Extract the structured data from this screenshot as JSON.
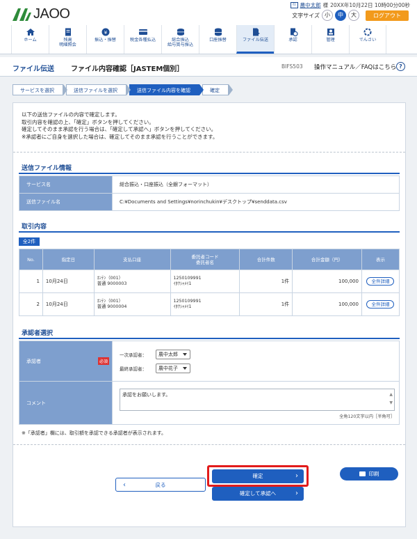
{
  "header": {
    "logo_text": "JAOO",
    "user_badge": "ﾏｽ",
    "user_name": "農中太郎",
    "user_suffix": "様",
    "last_login": "20XX年10月22日 10時00分00秒",
    "font_size_label": "文字サイズ",
    "font_sizes": [
      "小",
      "中",
      "大"
    ],
    "logout_label": "ログアウト"
  },
  "gnav": [
    {
      "label": "ホーム",
      "icon": "home-icon"
    },
    {
      "label": "残高\n明細照会",
      "icon": "document-icon"
    },
    {
      "label": "振込・振替",
      "icon": "yen-coin-icon"
    },
    {
      "label": "税金各種払込",
      "icon": "card-icon"
    },
    {
      "label": "総合振込\n給与賞与振込",
      "icon": "coins-stack-icon"
    },
    {
      "label": "口座振替",
      "icon": "database-icon"
    },
    {
      "label": "ファイル伝送",
      "icon": "file-transfer-icon",
      "active": true
    },
    {
      "label": "承認",
      "icon": "approval-icon"
    },
    {
      "label": "管理",
      "icon": "admin-icon"
    },
    {
      "label": "でんさい",
      "icon": "densai-icon"
    }
  ],
  "titlebar": {
    "service": "ファイル伝送",
    "page_title": "ファイル内容確認［JASTEM個別］",
    "screen_code": "BIFS503",
    "help_text": "操作マニュアル／FAQはこちら",
    "help_icon": "?"
  },
  "steps": [
    "サービスを選択",
    "送信ファイルを選択",
    "送信ファイル内容を確認",
    "確定"
  ],
  "intro_lines": [
    "以下の送信ファイルの内容で確定します。",
    "取引内容を確認の上、「確定」ボタンを押してください。",
    "確定してそのまま承認を行う場合は、「確定して承認へ」ボタンを押してください。",
    "※承認者にご自身を選択した場合は、確定してそのまま承認を行うことができます。"
  ],
  "file_info": {
    "title": "送信ファイル情報",
    "rows": [
      {
        "key": "サービス名",
        "value": "総合振込・口座振込（全銀フォーマット）"
      },
      {
        "key": "送信ファイル名",
        "value": "C:¥Documents and Settings¥norinchukin¥デスクトップ¥senddata.csv"
      }
    ]
  },
  "transactions": {
    "title": "取引内容",
    "count_label": "全2件",
    "headers": [
      "No.",
      "指定日",
      "支払口座",
      "委託者コード\n委託者名",
      "合計件数",
      "合計金額（円）",
      "表示"
    ],
    "rows": [
      {
        "no": "1",
        "date": "10月24日",
        "acct1": "ﾎﾝﾃﾝ（001）",
        "acct2": "普通 9000003",
        "code": "1250109991",
        "name": "ｲﾀｸｼｬﾒｲ1",
        "count": "1件",
        "amount": "100,000",
        "action": "全件詳細"
      },
      {
        "no": "2",
        "date": "10月24日",
        "acct1": "ﾎﾝﾃﾝ（001）",
        "acct2": "普通 9000004",
        "code": "1250109991",
        "name": "ｲﾀｸｼｬﾒｲ1",
        "count": "1件",
        "amount": "100,000",
        "action": "全件詳細"
      }
    ]
  },
  "approver": {
    "title": "承認者選択",
    "approver_label": "承認者",
    "required_label": "必須",
    "first_label": "一次承認者：",
    "first_value": "農中太郎",
    "final_label": "最終承認者：",
    "final_value": "農中花子",
    "comment_label": "コメント",
    "comment_value": "承認をお願いします。",
    "comment_limit": "全角120文字以内［半角可］"
  },
  "note": "※「承認者」欄には、取引額を承認できる承認者が表示されます。",
  "buttons": {
    "back": "戻る",
    "confirm": "確定",
    "confirm_approve": "確定して承認へ",
    "print": "印刷"
  },
  "colors": {
    "brand_blue": "#1f5fbf",
    "header_cell": "#7e9fce",
    "logout_orange": "#f29a1c",
    "highlight_red": "#e21b1b"
  }
}
